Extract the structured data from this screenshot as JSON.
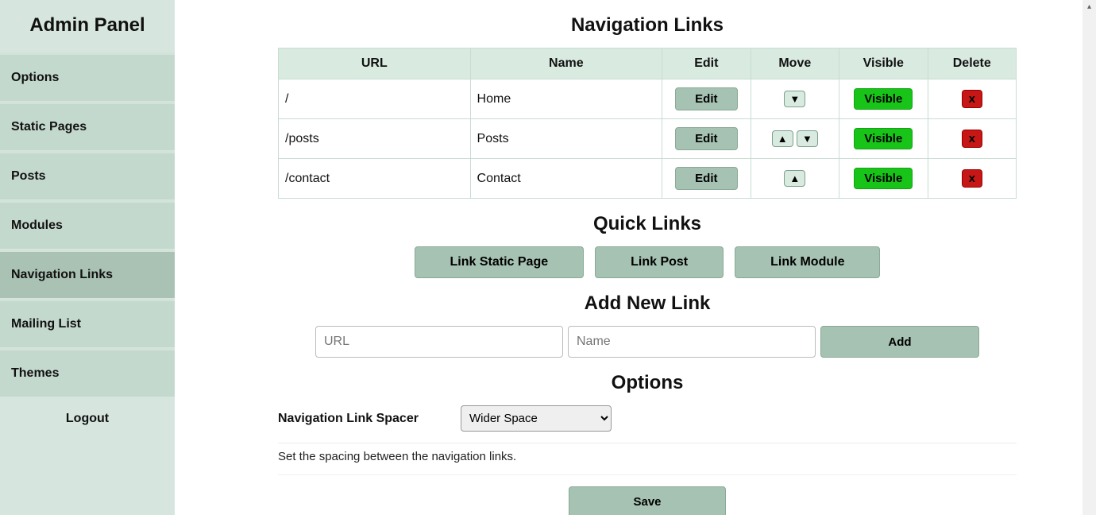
{
  "sidebar": {
    "title": "Admin Panel",
    "items": [
      {
        "label": "Options"
      },
      {
        "label": "Static Pages"
      },
      {
        "label": "Posts"
      },
      {
        "label": "Modules"
      },
      {
        "label": "Navigation Links"
      },
      {
        "label": "Mailing List"
      },
      {
        "label": "Themes"
      }
    ],
    "logout": "Logout"
  },
  "page": {
    "heading": "Navigation Links",
    "table": {
      "headers": {
        "url": "URL",
        "name": "Name",
        "edit": "Edit",
        "move": "Move",
        "visible": "Visible",
        "delete": "Delete"
      },
      "rows": [
        {
          "url": "/",
          "name": "Home",
          "edit": "Edit",
          "visible": "Visible",
          "delete": "x"
        },
        {
          "url": "/posts",
          "name": "Posts",
          "edit": "Edit",
          "visible": "Visible",
          "delete": "x"
        },
        {
          "url": "/contact",
          "name": "Contact",
          "edit": "Edit",
          "visible": "Visible",
          "delete": "x"
        }
      ]
    },
    "quick": {
      "heading": "Quick Links",
      "link_static": "Link Static Page",
      "link_post": "Link Post",
      "link_module": "Link Module"
    },
    "addnew": {
      "heading": "Add New Link",
      "url_placeholder": "URL",
      "name_placeholder": "Name",
      "add_label": "Add"
    },
    "options": {
      "heading": "Options",
      "spacer_label": "Navigation Link Spacer",
      "spacer_value": "Wider Space",
      "spacer_desc": "Set the spacing between the navigation links.",
      "save": "Save"
    }
  }
}
